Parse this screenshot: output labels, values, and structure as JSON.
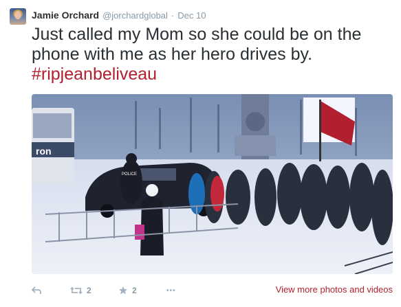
{
  "tweet": {
    "author_name": "Jamie Orchard",
    "handle": "@jorchardglobal",
    "separator": "·",
    "date": "Dec 10",
    "text_line1": "Just called my Mom so she could be on the",
    "text_line2": "phone with me as her hero drives by.",
    "hashtag": "#ripjeanbeliveau"
  },
  "photo": {
    "bus_sign": "ron",
    "police_text": "POLICE"
  },
  "actions": {
    "retweet_count": "2",
    "favorite_count": "2",
    "more_glyph": "•••",
    "view_more_label": "View more photos and videos"
  },
  "colors": {
    "link_red": "#b2202f",
    "muted_gray": "#8899a6",
    "text_dark": "#292f33"
  }
}
